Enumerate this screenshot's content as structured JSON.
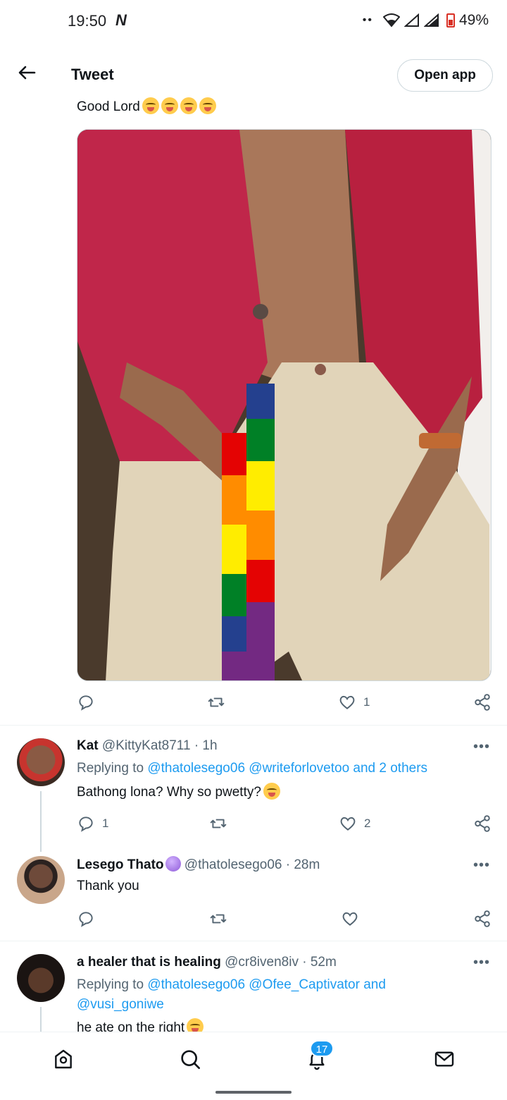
{
  "status_bar": {
    "time": "19:50",
    "network_glyph": "N",
    "battery": "49%",
    "battery_color": "#d93025"
  },
  "header": {
    "title": "Tweet",
    "open_app_label": "Open app",
    "back_icon": "arrow-left-icon"
  },
  "tweet": {
    "text": "Good Lord",
    "image_description_icon": "photo",
    "actions": {
      "replies": "",
      "retweets": "",
      "likes": "1"
    }
  },
  "replies": [
    {
      "name": "Kat",
      "handle": "@KittyKat8711",
      "time": "· 1h",
      "replying_prefix": "Replying to",
      "replying_mentions": "@thatolesego06 @writeforlovetoo and 2 others",
      "text": "Bathong lona? Why so pwetty?",
      "reply_count": "1",
      "retweet_count": "",
      "like_count": "2"
    },
    {
      "name": "Lesego Thato",
      "handle": "@thatolesego06",
      "time": "· 28m",
      "text": "Thank you",
      "reply_count": "",
      "retweet_count": "",
      "like_count": ""
    },
    {
      "name": "a healer that is healing",
      "handle": "@cr8iven8iv",
      "time": "· 52m",
      "replying_prefix": "Replying to",
      "replying_mentions_line1": "@thatolesego06 @Ofee_Captivator and",
      "replying_mentions_line2": "@vusi_goniwe",
      "text": "he ate on the right"
    }
  ],
  "more_label": "•••",
  "bottom_nav": {
    "items": [
      "home-icon",
      "search-icon",
      "notifications-icon",
      "messages-icon"
    ],
    "notifications_count": "17"
  },
  "colors": {
    "accent": "#1d9bf0",
    "text": "#0f1419",
    "muted": "#536471"
  }
}
